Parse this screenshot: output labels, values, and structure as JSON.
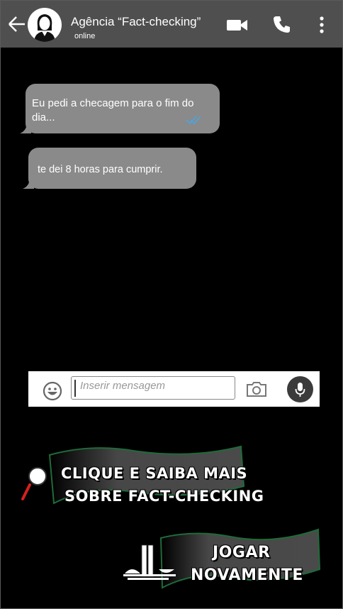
{
  "header": {
    "contact_name": "Agência “Fact-checking”",
    "status": "online",
    "icons": [
      "back-arrow-icon",
      "avatar-woman-icon",
      "video-call-icon",
      "phone-icon",
      "more-vert-icon"
    ],
    "bg_color": "#4f4f4f"
  },
  "messages": [
    {
      "text": "Eu pedi a checagem para o fim do dia...",
      "read_ticks": true
    },
    {
      "text": "te dei 8 horas para cumprir."
    }
  ],
  "composer": {
    "placeholder": "Inserir mensagem",
    "icons": [
      "emoji-icon",
      "camera-icon",
      "mic-icon"
    ]
  },
  "cta_learn": {
    "line1": "Clique e saiba mais",
    "line2": "sobre Fact-checking",
    "icon": "magnifier-icon"
  },
  "cta_replay": {
    "line1": "Jogar",
    "line2": "novamente",
    "icon": "congress-building-icon"
  },
  "colors": {
    "bubble": "#8a8a8a",
    "banner": "#4a4a4a",
    "banner_border": "#1f6b3a",
    "ticks": "#4fa3d9",
    "magnifier_handle": "#d42020"
  }
}
